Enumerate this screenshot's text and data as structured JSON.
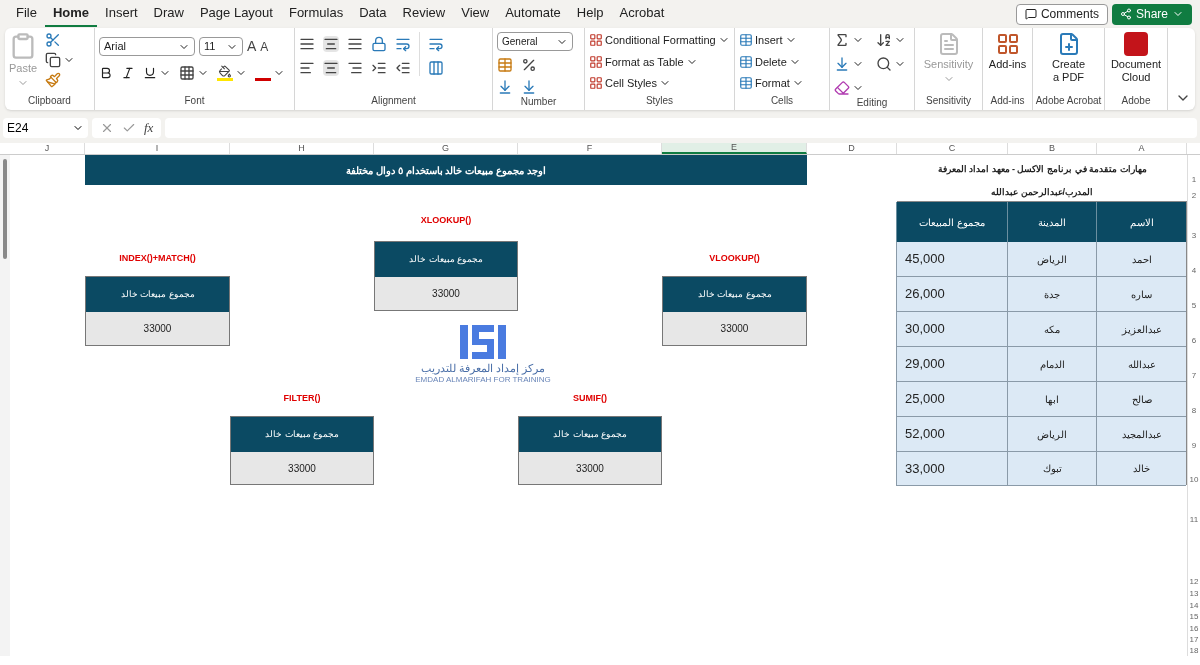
{
  "menu_tabs": {
    "file": {
      "label": "File",
      "selected": false
    },
    "home": {
      "label": "Home",
      "selected": true
    },
    "insert": {
      "label": "Insert",
      "selected": false
    },
    "draw": {
      "label": "Draw",
      "selected": false
    },
    "page_layout": {
      "label": "Page Layout",
      "selected": false
    },
    "formulas": {
      "label": "Formulas",
      "selected": false
    },
    "data": {
      "label": "Data",
      "selected": false
    },
    "review": {
      "label": "Review",
      "selected": false
    },
    "view": {
      "label": "View",
      "selected": false
    },
    "automate": {
      "label": "Automate",
      "selected": false
    },
    "help": {
      "label": "Help",
      "selected": false
    },
    "acrobat": {
      "label": "Acrobat",
      "selected": false
    }
  },
  "header_buttons": {
    "comments": "Comments",
    "share": "Share"
  },
  "ribbon": {
    "paste": {
      "label": "Paste",
      "disabled": true
    },
    "font": "Arial",
    "font_size": "11",
    "grow_font": "A",
    "shrink_font": "A",
    "number_format": "General",
    "styles": [
      "Conditional Formatting",
      "Format as Table",
      "Cell Styles"
    ],
    "cells": [
      "Insert",
      "Delete",
      "Format"
    ],
    "sensitivity": {
      "label": "Sensitivity",
      "disabled": true
    },
    "add_ins": "Add-ins",
    "create_pdf": [
      "Create",
      "a PDF"
    ],
    "document_cloud": [
      "Document",
      "Cloud"
    ],
    "groups": {
      "clipboard": "Clipboard",
      "font": "Font",
      "alignment": "Alignment",
      "number": "Number",
      "styles": "Styles",
      "cells": "Cells",
      "editing": "Editing",
      "sensitivity": "Sensitivity",
      "add_ins": "Add-ins",
      "adobe_acrobat": "Adobe Acrobat",
      "adobe": "Adobe"
    }
  },
  "formula_bar": {
    "name_box": "E24",
    "fx": "fx"
  },
  "columns": [
    {
      "label": "A",
      "selected": false
    },
    {
      "label": "B",
      "selected": false
    },
    {
      "label": "C",
      "selected": false
    },
    {
      "label": "D",
      "selected": false
    },
    {
      "label": "E",
      "selected": true
    },
    {
      "label": "F",
      "selected": false
    },
    {
      "label": "G",
      "selected": false
    },
    {
      "label": "H",
      "selected": false
    },
    {
      "label": "I",
      "selected": false
    },
    {
      "label": "J",
      "selected": false
    }
  ],
  "rows": [
    "1",
    "2",
    "3",
    "4",
    "5",
    "6",
    "7",
    "8",
    "9",
    "10",
    "11",
    "12",
    "13",
    "14",
    "15",
    "16",
    "17",
    "18"
  ],
  "sheet": {
    "title": "اوجد مجموع مبيعات خالد باستخدام ٥ دوال مختلفة",
    "cards": [
      {
        "function": "XLOOKUP()",
        "header": "مجموع مبيعات خالد",
        "value": "33000"
      },
      {
        "function": "VLOOKUP()",
        "header": "مجموع مبيعات خالد",
        "value": "33000"
      },
      {
        "function": "INDEX()+MATCH()",
        "header": "مجموع مبيعات خالد",
        "value": "33000"
      },
      {
        "function": "SUMIF()",
        "header": "مجموع مبيعات خالد",
        "value": "33000"
      },
      {
        "function": "FILTER()",
        "header": "مجموع مبيعات خالد",
        "value": "33000"
      }
    ],
    "logo": {
      "arabic": "مركز إمداد المعرفة للتدريب",
      "english": "EMDAD ALMARIFAH FOR TRAINING"
    },
    "table_title": "مهارات متقدمة في برنامج الاكسل - معهد امداد المعرفة",
    "table_subtitle": "المدرب/عبدالرحمن عبدالله",
    "table": {
      "columns": [
        "الاسم",
        "المدينة",
        "مجموع المبيعات"
      ],
      "rows": [
        [
          "احمد",
          "الرياض",
          "45,000"
        ],
        [
          "ساره",
          "جدة",
          "26,000"
        ],
        [
          "عبدالعزيز",
          "مكه",
          "30,000"
        ],
        [
          "عبدالله",
          "الدمام",
          "29,000"
        ],
        [
          "صالح",
          "ابها",
          "25,000"
        ],
        [
          "عبدالمجيد",
          "الرياض",
          "52,000"
        ],
        [
          "خالد",
          "تبوك",
          "33,000"
        ]
      ]
    }
  }
}
